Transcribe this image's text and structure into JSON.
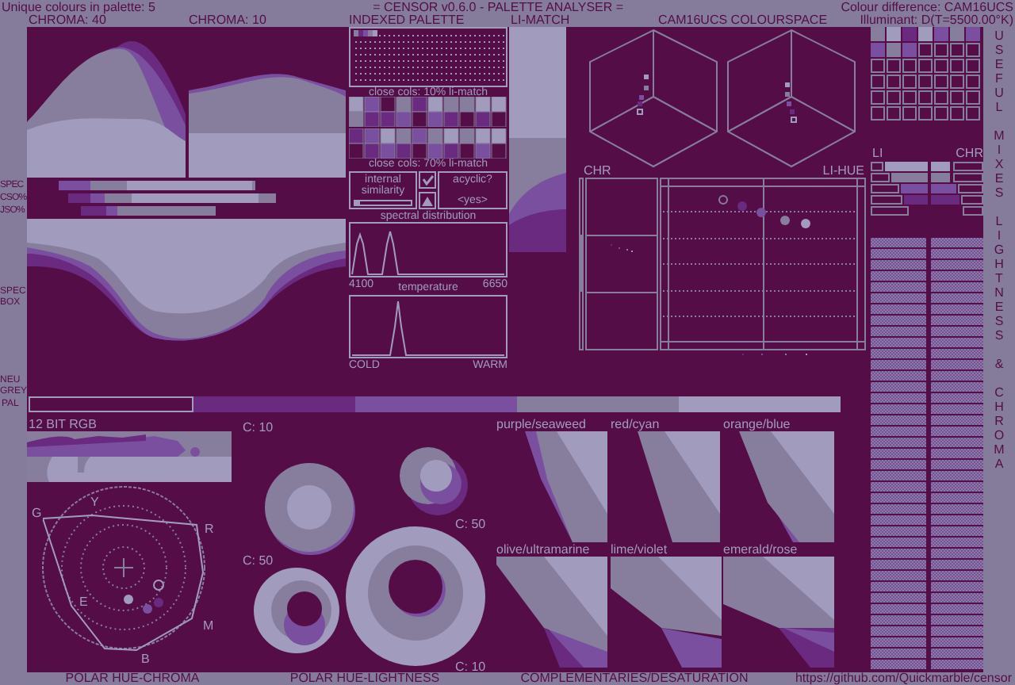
{
  "header": {
    "palette_count": "Unique colours in palette: 5",
    "title": "= CENSOR v0.6.0 - PALETTE ANALYSER =",
    "colour_difference": "Colour difference: CAM16UCS",
    "illuminant": "Illuminant: D(T=5500.00°K)"
  },
  "spectrum": {
    "labels": [
      "CHROMA: 40",
      "CHROMA: 10"
    ]
  },
  "metrics": [
    {
      "label": "SPEC"
    },
    {
      "label": "CSO%"
    },
    {
      "label": "JSO%"
    }
  ],
  "spec_box": {
    "label": "SPEC BOX"
  },
  "neutral_grey": {
    "label": "NEU GREY"
  },
  "palette": {
    "label": "PAL",
    "colors": [
      {
        "color": "#550d47"
      },
      {
        "color": "#6a2a80"
      },
      {
        "color": "#7a4fa0"
      },
      {
        "color": "#877e9e"
      },
      {
        "color": "#a19cbe"
      }
    ]
  },
  "indexed_palette": {
    "title": "INDEXED PALETTE",
    "close_cols": [
      "close cols: 10% li-match",
      "close cols: 70% li-match"
    ],
    "internal_similarity": {
      "label": "internal similarity",
      "level": 0.08
    },
    "acyclic": {
      "label": "acyclic?",
      "checked": true,
      "value": "<yes>"
    }
  },
  "spectral_distribution": {
    "title": "spectral distribution",
    "min": "4100",
    "max": "6650"
  },
  "temperature": {
    "title": "temperature",
    "min": "COLD",
    "max": "WARM"
  },
  "li_match": {
    "title": "LI-MATCH"
  },
  "colourspace": {
    "title": "CAM16UCS COLOURSPACE"
  },
  "chr_plot": {
    "title": "CHR"
  },
  "li_hue": {
    "title": "LI-HUE"
  },
  "mixes": {
    "li": "LI",
    "chr": "CHR",
    "side_title": "USEFUL MIXES LIGHTNESS & CHROMA"
  },
  "rgb12": {
    "title": "12 BIT RGB"
  },
  "polar_hue_chroma": {
    "title": "POLAR HUE-CHROMA",
    "hue_labels": [
      "G",
      "Y",
      "R",
      "E",
      "M",
      "B"
    ]
  },
  "polar_hue_lightness": {
    "title": "POLAR HUE-LIGHTNESS",
    "discs": [
      {
        "label": "C: 10"
      },
      {
        "label": "C: 50"
      },
      {
        "label": "C: 50"
      },
      {
        "label": "C: 10"
      }
    ]
  },
  "complementaries": {
    "title": "COMPLEMENTARIES/DESATURATION",
    "pairs": [
      "purple/seaweed",
      "red/cyan",
      "orange/blue",
      "olive/ultramarine",
      "lime/violet",
      "emerald/rose"
    ]
  },
  "footer": {
    "url": "https://github.com/Quickmarble/censor"
  }
}
